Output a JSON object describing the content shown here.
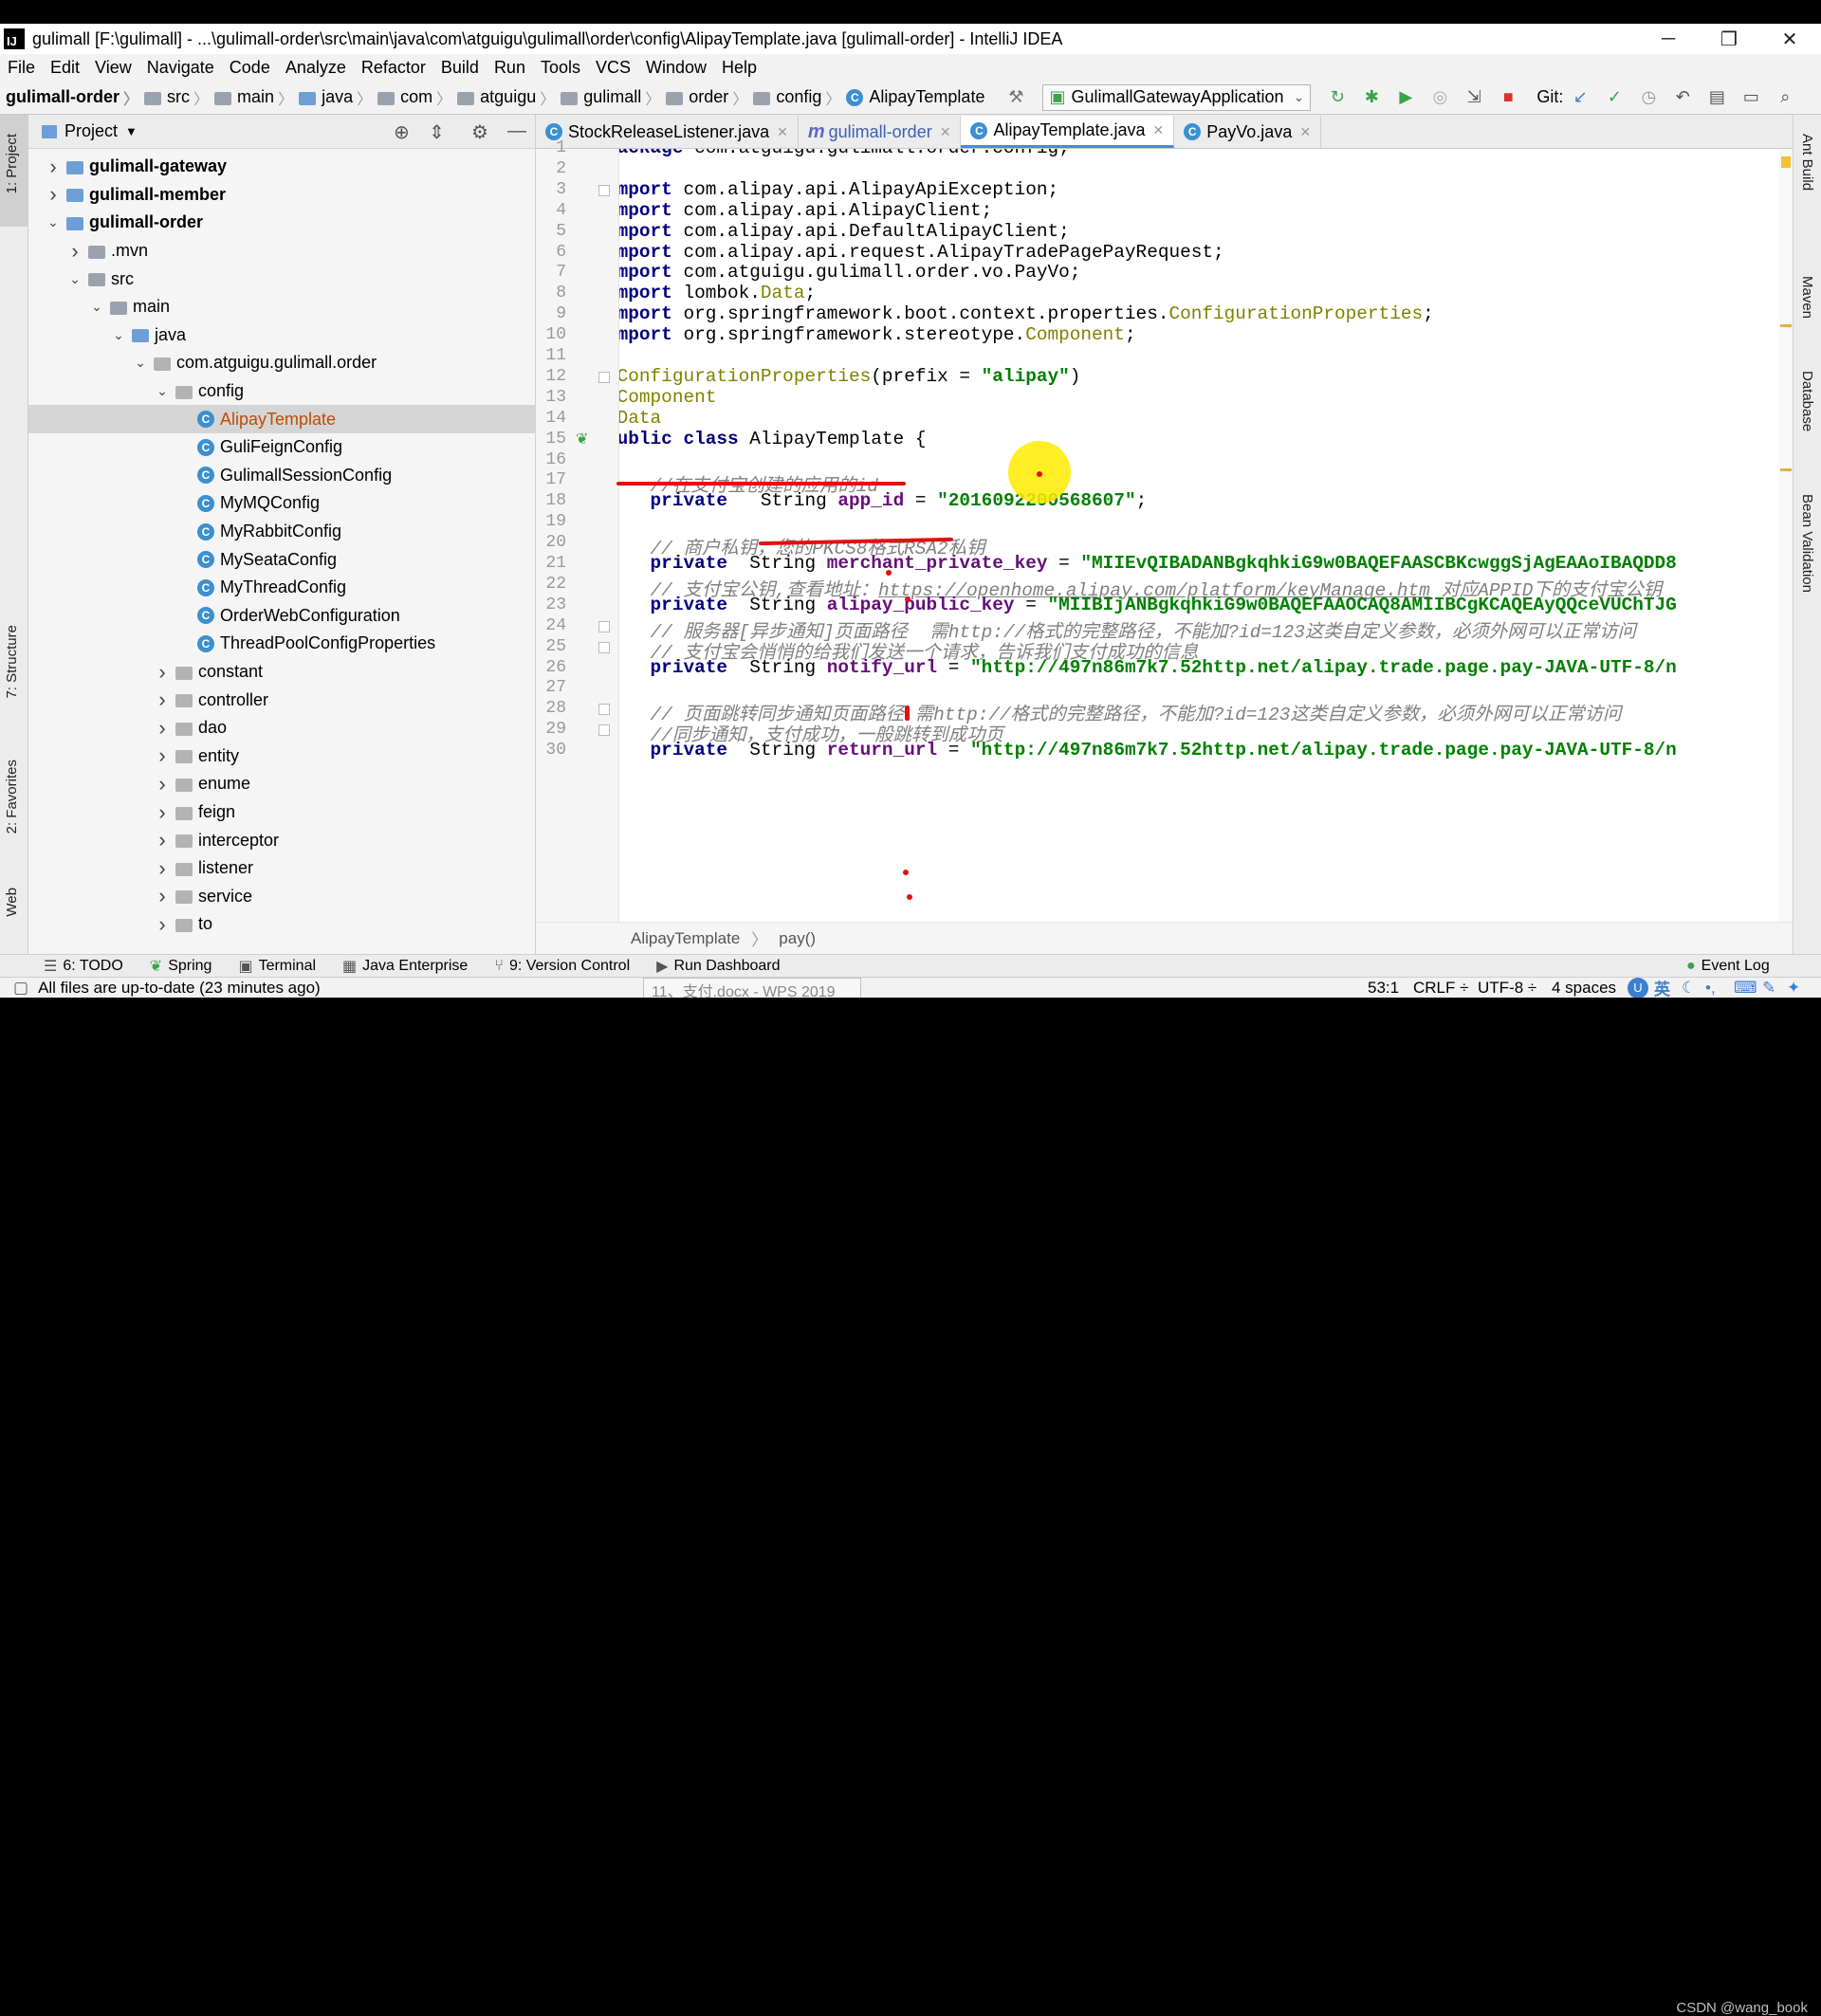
{
  "window": {
    "title": "gulimall [F:\\gulimall] - ...\\gulimall-order\\src\\main\\java\\com\\atguigu\\gulimall\\order\\config\\AlipayTemplate.java [gulimall-order] - IntelliJ IDEA",
    "logo": "IJ"
  },
  "menu": [
    "File",
    "Edit",
    "View",
    "Navigate",
    "Code",
    "Analyze",
    "Refactor",
    "Build",
    "Run",
    "Tools",
    "VCS",
    "Window",
    "Help"
  ],
  "breadcrumb": [
    "gulimall-order",
    "src",
    "main",
    "java",
    "com",
    "atguigu",
    "gulimall",
    "order",
    "config",
    "AlipayTemplate"
  ],
  "toolbar": {
    "run_config": "GulimallGatewayApplication",
    "git_label": "Git:"
  },
  "left_strip": {
    "project": "1: Project",
    "structure": "7: Structure",
    "favorites": "2: Favorites",
    "web": "Web"
  },
  "right_strip": {
    "ant": "Ant Build",
    "maven": "Maven",
    "database": "Database",
    "bean": "Bean Validation"
  },
  "project_panel": {
    "title": "Project",
    "tree": [
      {
        "label": "gulimall-gateway",
        "depth": 0,
        "arrow": "right",
        "icon": "module",
        "bold": true
      },
      {
        "label": "gulimall-member",
        "depth": 0,
        "arrow": "right",
        "icon": "module",
        "bold": true
      },
      {
        "label": "gulimall-order",
        "depth": 0,
        "arrow": "down",
        "icon": "module",
        "bold": true
      },
      {
        "label": ".mvn",
        "depth": 1,
        "arrow": "right",
        "icon": "folder"
      },
      {
        "label": "src",
        "depth": 1,
        "arrow": "down",
        "icon": "folder"
      },
      {
        "label": "main",
        "depth": 2,
        "arrow": "down",
        "icon": "folder"
      },
      {
        "label": "java",
        "depth": 3,
        "arrow": "down",
        "icon": "folder-blue"
      },
      {
        "label": "com.atguigu.gulimall.order",
        "depth": 4,
        "arrow": "down",
        "icon": "package"
      },
      {
        "label": "config",
        "depth": 5,
        "arrow": "down",
        "icon": "package"
      },
      {
        "label": "AlipayTemplate",
        "depth": 6,
        "arrow": "",
        "icon": "class",
        "selected": true,
        "orange": true
      },
      {
        "label": "GuliFeignConfig",
        "depth": 6,
        "arrow": "",
        "icon": "class"
      },
      {
        "label": "GulimallSessionConfig",
        "depth": 6,
        "arrow": "",
        "icon": "class"
      },
      {
        "label": "MyMQConfig",
        "depth": 6,
        "arrow": "",
        "icon": "class"
      },
      {
        "label": "MyRabbitConfig",
        "depth": 6,
        "arrow": "",
        "icon": "class"
      },
      {
        "label": "MySeataConfig",
        "depth": 6,
        "arrow": "",
        "icon": "class"
      },
      {
        "label": "MyThreadConfig",
        "depth": 6,
        "arrow": "",
        "icon": "class"
      },
      {
        "label": "OrderWebConfiguration",
        "depth": 6,
        "arrow": "",
        "icon": "class"
      },
      {
        "label": "ThreadPoolConfigProperties",
        "depth": 6,
        "arrow": "",
        "icon": "class"
      },
      {
        "label": "constant",
        "depth": 5,
        "arrow": "right",
        "icon": "package"
      },
      {
        "label": "controller",
        "depth": 5,
        "arrow": "right",
        "icon": "package"
      },
      {
        "label": "dao",
        "depth": 5,
        "arrow": "right",
        "icon": "package"
      },
      {
        "label": "entity",
        "depth": 5,
        "arrow": "right",
        "icon": "package"
      },
      {
        "label": "enume",
        "depth": 5,
        "arrow": "right",
        "icon": "package"
      },
      {
        "label": "feign",
        "depth": 5,
        "arrow": "right",
        "icon": "package"
      },
      {
        "label": "interceptor",
        "depth": 5,
        "arrow": "right",
        "icon": "package"
      },
      {
        "label": "listener",
        "depth": 5,
        "arrow": "right",
        "icon": "package"
      },
      {
        "label": "service",
        "depth": 5,
        "arrow": "right",
        "icon": "package"
      },
      {
        "label": "to",
        "depth": 5,
        "arrow": "right",
        "icon": "package"
      }
    ]
  },
  "editor": {
    "tabs": [
      {
        "label": "StockReleaseListener.java",
        "icon": "C",
        "active": false
      },
      {
        "label": "gulimall-order",
        "icon": "m",
        "active": false
      },
      {
        "label": "AlipayTemplate.java",
        "icon": "C",
        "active": true
      },
      {
        "label": "PayVo.java",
        "icon": "C",
        "active": false
      }
    ],
    "lines": [
      {
        "n": "1",
        "html": "<span class=\"kw\">package</span> com.atguigu.gulimall.order.config;"
      },
      {
        "n": "2",
        "html": ""
      },
      {
        "n": "3",
        "html": "<span class=\"kw\">import</span> com.alipay.api.AlipayApiException;"
      },
      {
        "n": "4",
        "html": "<span class=\"kw\">import</span> com.alipay.api.AlipayClient;"
      },
      {
        "n": "5",
        "html": "<span class=\"kw\">import</span> com.alipay.api.DefaultAlipayClient;"
      },
      {
        "n": "6",
        "html": "<span class=\"kw\">import</span> com.alipay.api.request.AlipayTradePagePayRequest;"
      },
      {
        "n": "7",
        "html": "<span class=\"kw\">import</span> com.atguigu.gulimall.order.vo.PayVo;"
      },
      {
        "n": "8",
        "html": "<span class=\"kw\">import</span> lombok.<span class=\"pkg\">Data</span>;"
      },
      {
        "n": "9",
        "html": "<span class=\"kw\">import</span> org.springframework.boot.context.properties.<span class=\"pkg\">ConfigurationProperties</span>;"
      },
      {
        "n": "10",
        "html": "<span class=\"kw\">import</span> org.springframework.stereotype.<span class=\"pkg\">Component</span>;"
      },
      {
        "n": "11",
        "html": ""
      },
      {
        "n": "12",
        "html": "<span class=\"ann\">@ConfigurationProperties</span>(prefix = <span class=\"str\">\"alipay\"</span>)"
      },
      {
        "n": "13",
        "html": "<span class=\"ann\">@Component</span>"
      },
      {
        "n": "14",
        "html": "<span class=\"ann\">@Data</span>"
      },
      {
        "n": "15",
        "html": "<span class=\"kw\">public class</span> AlipayTemplate {"
      },
      {
        "n": "16",
        "html": ""
      },
      {
        "n": "17",
        "html": "    <span class=\"cmt\">//在支付宝创建的应用的id</span>"
      },
      {
        "n": "18",
        "html": "    <span class=\"kw\">private</span>   String <span class=\"fld\">app_id</span> = <span class=\"str\">\"2016092200568607\"</span>;"
      },
      {
        "n": "19",
        "html": ""
      },
      {
        "n": "20",
        "html": "    <span class=\"cmt\">// 商户私钥，您的PKCS8格式RSA2私钥</span>"
      },
      {
        "n": "21",
        "html": "    <span class=\"kw\">private</span>  String <span class=\"fld\">merchant_private_key</span> = <span class=\"str\">\"MIIEvQIBADANBgkqhkiG9w0BAQEFAASCBKcwggSjAgEAAoIBAQDD8</span>"
      },
      {
        "n": "22",
        "html": "    <span class=\"cmt\">// 支付宝公钥,查看地址：<span class=\"url\">https://openhome.alipay.com/platform/keyManage.htm</span> 对应APPID下的支付宝公钥</span>"
      },
      {
        "n": "23",
        "html": "    <span class=\"kw\">private</span>  String <span class=\"fld\">alipay_public_key</span> = <span class=\"str\">\"MIIBIjANBgkqhkiG9w0BAQEFAAOCAQ8AMIIBCgKCAQEAyQQceVUChTJG</span>"
      },
      {
        "n": "24",
        "html": "    <span class=\"cmt\">// 服务器[异步通知]页面路径  需http://格式的完整路径，不能加?id=123这类自定义参数，必须外网可以正常访问</span>"
      },
      {
        "n": "25",
        "html": "    <span class=\"cmt\">// 支付宝会悄悄的给我们发送一个请求，告诉我们支付成功的信息</span>"
      },
      {
        "n": "26",
        "html": "    <span class=\"kw\">private</span>  String <span class=\"fld\">notify_url</span> = <span class=\"str\">\"http://497n86m7k7.52http.net/alipay.trade.page.pay-JAVA-UTF-8/n</span>"
      },
      {
        "n": "27",
        "html": ""
      },
      {
        "n": "28",
        "html": "    <span class=\"cmt\">// 页面跳转同步通知页面路径 需http://格式的完整路径，不能加?id=123这类自定义参数，必须外网可以正常访问</span>"
      },
      {
        "n": "29",
        "html": "    <span class=\"cmt\">//同步通知，支付成功，一般跳转到成功页</span>"
      },
      {
        "n": "30",
        "html": "    <span class=\"kw\">private</span>  String <span class=\"fld\">return_url</span> = <span class=\"str\">\"http://497n86m7k7.52http.net/alipay.trade.page.pay-JAVA-UTF-8/n</span>"
      }
    ],
    "breadcrumb": [
      "AlipayTemplate",
      "pay()"
    ]
  },
  "tool_windows": [
    "6: TODO",
    "Spring",
    "Terminal",
    "Java Enterprise",
    "9: Version Control",
    "Run Dashboard",
    "Event Log"
  ],
  "status": {
    "message": "All files are up-to-date (23 minutes ago)",
    "taskbar_item": "11、支付.docx - WPS 2019",
    "position": "53:1",
    "line_sep": "CRLF ÷",
    "encoding": "UTF-8 ÷",
    "indent": "4 spaces",
    "ime": "英"
  },
  "watermark": "CSDN @wang_book",
  "colors": {
    "keyword": "#000080",
    "string": "#008000",
    "annotation": "#808000",
    "comment": "#808080",
    "field": "#660e7a",
    "accent": "#4a89dc",
    "pointer": "#ffeb00",
    "ink": "#e31010"
  }
}
